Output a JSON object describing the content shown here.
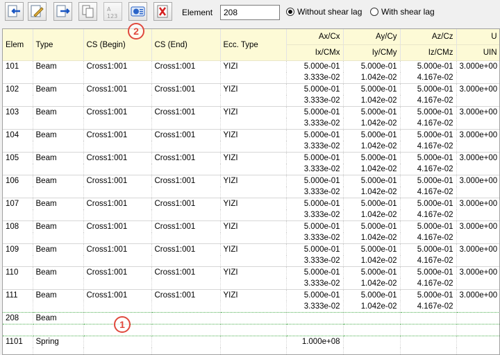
{
  "toolbar": {
    "buttons": [
      {
        "name": "import-icon"
      },
      {
        "name": "edit-icon"
      },
      {
        "name": "export-icon"
      },
      {
        "name": "copy-icon"
      },
      {
        "name": "numbering-icon"
      },
      {
        "name": "info-icon"
      },
      {
        "name": "delete-icon"
      }
    ],
    "element_label": "Element",
    "element_value": "208",
    "radio_without": "Without shear lag",
    "radio_with": "With shear lag",
    "selected_radio": "without"
  },
  "callouts": [
    "1",
    "2"
  ],
  "table": {
    "headers": {
      "elem": "Elem",
      "type": "Type",
      "cs_begin": "CS (Begin)",
      "cs_end": "CS (End)",
      "ecc": "Ecc. Type",
      "ax": "Ax/Cx",
      "ix": "Ix/CMx",
      "ay": "Ay/Cy",
      "iy": "Iy/CMy",
      "az": "Az/Cz",
      "iz": "Iz/CMz",
      "u": "U",
      "uin": "UIN"
    },
    "rows": [
      {
        "elem": "101",
        "type": "Beam",
        "csb": "Cross1:001",
        "cse": "Cross1:001",
        "ecc": "YIZI",
        "ax": "5.000e-01",
        "ay": "5.000e-01",
        "az": "5.000e-01",
        "u": "3.000e+00",
        "ix": "3.333e-02",
        "iy": "1.042e-02",
        "iz": "4.167e-02"
      },
      {
        "elem": "102",
        "type": "Beam",
        "csb": "Cross1:001",
        "cse": "Cross1:001",
        "ecc": "YIZI",
        "ax": "5.000e-01",
        "ay": "5.000e-01",
        "az": "5.000e-01",
        "u": "3.000e+00",
        "ix": "3.333e-02",
        "iy": "1.042e-02",
        "iz": "4.167e-02"
      },
      {
        "elem": "103",
        "type": "Beam",
        "csb": "Cross1:001",
        "cse": "Cross1:001",
        "ecc": "YIZI",
        "ax": "5.000e-01",
        "ay": "5.000e-01",
        "az": "5.000e-01",
        "u": "3.000e+00",
        "ix": "3.333e-02",
        "iy": "1.042e-02",
        "iz": "4.167e-02"
      },
      {
        "elem": "104",
        "type": "Beam",
        "csb": "Cross1:001",
        "cse": "Cross1:001",
        "ecc": "YIZI",
        "ax": "5.000e-01",
        "ay": "5.000e-01",
        "az": "5.000e-01",
        "u": "3.000e+00",
        "ix": "3.333e-02",
        "iy": "1.042e-02",
        "iz": "4.167e-02"
      },
      {
        "elem": "105",
        "type": "Beam",
        "csb": "Cross1:001",
        "cse": "Cross1:001",
        "ecc": "YIZI",
        "ax": "5.000e-01",
        "ay": "5.000e-01",
        "az": "5.000e-01",
        "u": "3.000e+00",
        "ix": "3.333e-02",
        "iy": "1.042e-02",
        "iz": "4.167e-02"
      },
      {
        "elem": "106",
        "type": "Beam",
        "csb": "Cross1:001",
        "cse": "Cross1:001",
        "ecc": "YIZI",
        "ax": "5.000e-01",
        "ay": "5.000e-01",
        "az": "5.000e-01",
        "u": "3.000e+00",
        "ix": "3.333e-02",
        "iy": "1.042e-02",
        "iz": "4.167e-02"
      },
      {
        "elem": "107",
        "type": "Beam",
        "csb": "Cross1:001",
        "cse": "Cross1:001",
        "ecc": "YIZI",
        "ax": "5.000e-01",
        "ay": "5.000e-01",
        "az": "5.000e-01",
        "u": "3.000e+00",
        "ix": "3.333e-02",
        "iy": "1.042e-02",
        "iz": "4.167e-02"
      },
      {
        "elem": "108",
        "type": "Beam",
        "csb": "Cross1:001",
        "cse": "Cross1:001",
        "ecc": "YIZI",
        "ax": "5.000e-01",
        "ay": "5.000e-01",
        "az": "5.000e-01",
        "u": "3.000e+00",
        "ix": "3.333e-02",
        "iy": "1.042e-02",
        "iz": "4.167e-02"
      },
      {
        "elem": "109",
        "type": "Beam",
        "csb": "Cross1:001",
        "cse": "Cross1:001",
        "ecc": "YIZI",
        "ax": "5.000e-01",
        "ay": "5.000e-01",
        "az": "5.000e-01",
        "u": "3.000e+00",
        "ix": "3.333e-02",
        "iy": "1.042e-02",
        "iz": "4.167e-02"
      },
      {
        "elem": "110",
        "type": "Beam",
        "csb": "Cross1:001",
        "cse": "Cross1:001",
        "ecc": "YIZI",
        "ax": "5.000e-01",
        "ay": "5.000e-01",
        "az": "5.000e-01",
        "u": "3.000e+00",
        "ix": "3.333e-02",
        "iy": "1.042e-02",
        "iz": "4.167e-02"
      },
      {
        "elem": "111",
        "type": "Beam",
        "csb": "Cross1:001",
        "cse": "Cross1:001",
        "ecc": "YIZI",
        "ax": "5.000e-01",
        "ay": "5.000e-01",
        "az": "5.000e-01",
        "u": "3.000e+00",
        "ix": "3.333e-02",
        "iy": "1.042e-02",
        "iz": "4.167e-02"
      },
      {
        "elem": "208",
        "type": "Beam",
        "csb": "",
        "cse": "",
        "ecc": "",
        "ax": "",
        "ay": "",
        "az": "",
        "u": "",
        "ix": "",
        "iy": "",
        "iz": "",
        "selected": true
      },
      {
        "elem": "1101",
        "type": "Spring",
        "csb": "",
        "cse": "",
        "ecc": "",
        "ax": "1.000e+08",
        "ay": "",
        "az": "",
        "u": "",
        "ix": "",
        "iy": "",
        "iz": ""
      }
    ]
  },
  "colors": {
    "header_bg": "#fdfad6",
    "callout": "#e0483c",
    "selection": "#4caf50"
  }
}
